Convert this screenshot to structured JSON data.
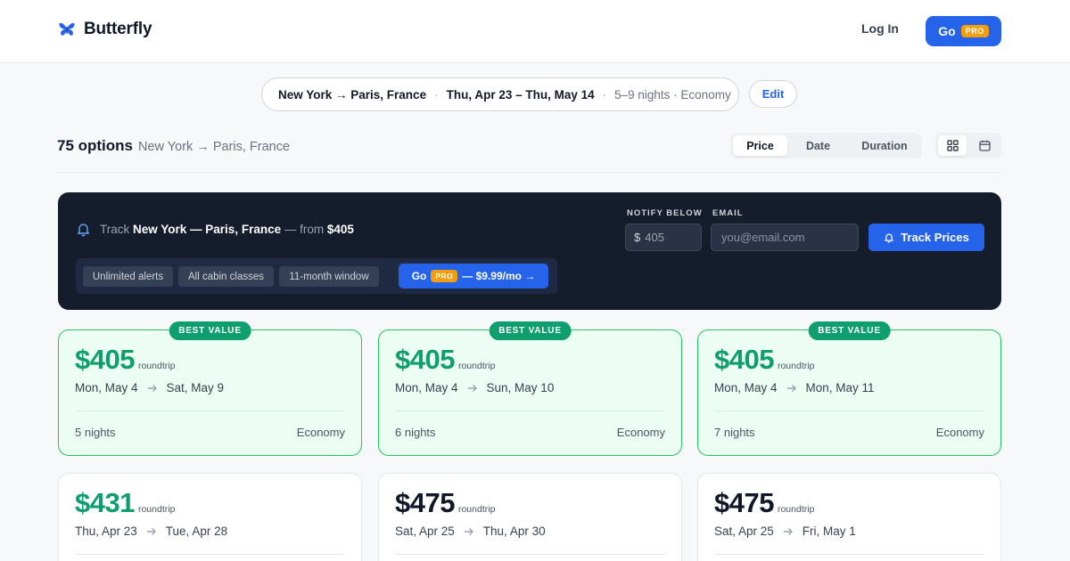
{
  "header": {
    "brand": "Butterfly",
    "login_label": "Log In",
    "go_label": "Go",
    "pro_label": "PRO"
  },
  "search": {
    "route": "New York → Paris, France",
    "dates": "Thu, Apr 23 – Thu, May 14",
    "details": "5–9 nights · Economy",
    "edit_label": "Edit"
  },
  "results": {
    "count": "75 options",
    "route": "New York → Paris, France",
    "sort_tabs": [
      {
        "label": "Price",
        "active": true
      },
      {
        "label": "Date",
        "active": false
      },
      {
        "label": "Duration",
        "active": false
      }
    ],
    "views": [
      {
        "icon": "grid-icon",
        "active": true
      },
      {
        "icon": "calendar-icon",
        "active": false
      }
    ]
  },
  "tracker": {
    "track_prefix": "Track",
    "route": "New York — Paris, France",
    "from_text": "— from",
    "from_price": "$405",
    "features": [
      "Unlimited alerts",
      "All cabin classes",
      "11-month window"
    ],
    "go_label": "Go",
    "pro_label": "PRO",
    "price_text": "— $9.99/mo →",
    "notify_label": "NOTIFY BELOW",
    "email_label": "EMAIL",
    "currency": "$",
    "notify_value": "405",
    "email_placeholder": "you@email.com",
    "track_button": "Track Prices"
  },
  "cards": [
    {
      "price": "$405",
      "trip": "roundtrip",
      "depart": "Mon, May 4",
      "return": "Sat, May 9",
      "nights": "5 nights",
      "cabin": "Economy",
      "badge": "BEST VALUE"
    },
    {
      "price": "$405",
      "trip": "roundtrip",
      "depart": "Mon, May 4",
      "return": "Sun, May 10",
      "nights": "6 nights",
      "cabin": "Economy",
      "badge": "BEST VALUE"
    },
    {
      "price": "$405",
      "trip": "roundtrip",
      "depart": "Mon, May 4",
      "return": "Mon, May 11",
      "nights": "7 nights",
      "cabin": "Economy",
      "badge": "BEST VALUE"
    },
    {
      "price": "$431",
      "trip": "roundtrip",
      "depart": "Thu, Apr 23",
      "return": "Tue, Apr 28"
    },
    {
      "price": "$475",
      "trip": "roundtrip",
      "depart": "Sat, Apr 25",
      "return": "Thu, Apr 30"
    },
    {
      "price": "$475",
      "trip": "roundtrip",
      "depart": "Sat, Apr 25",
      "return": "Fri, May 1"
    }
  ],
  "colors": {
    "accent": "#2563eb",
    "best_green": "#0f9f6e",
    "pro_badge": "#f59e0b",
    "tracker_bg": "#151c2c"
  }
}
